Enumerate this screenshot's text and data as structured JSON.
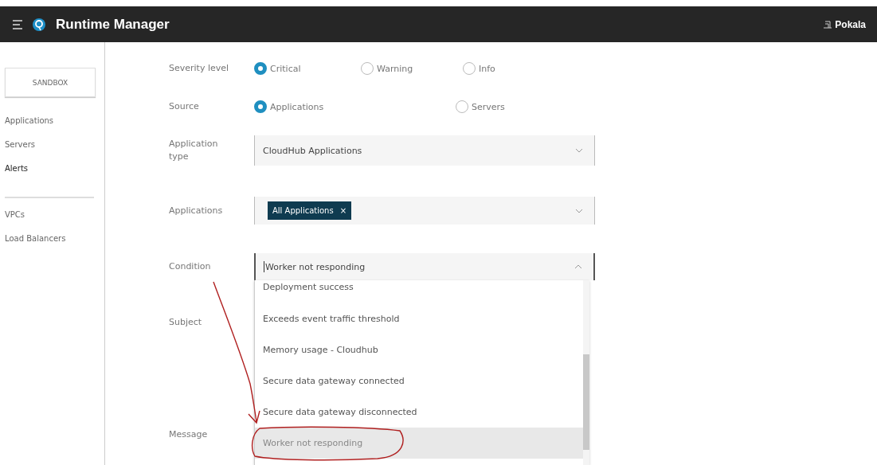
{
  "top_bar": {
    "title": "Runtime Manager",
    "user": "Pokala"
  },
  "sidebar": {
    "environment": "SANDBOX",
    "groups": [
      [
        {
          "label": "Applications",
          "selected": false
        },
        {
          "label": "Servers",
          "selected": false
        },
        {
          "label": "Alerts",
          "selected": true
        }
      ],
      [
        {
          "label": "VPCs",
          "selected": false
        },
        {
          "label": "Load Balancers",
          "selected": false
        }
      ]
    ]
  },
  "form": {
    "severity": {
      "label": "Severity level",
      "options": [
        {
          "label": "Critical",
          "selected": true
        },
        {
          "label": "Warning",
          "selected": false
        },
        {
          "label": "Info",
          "selected": false
        }
      ]
    },
    "source": {
      "label": "Source",
      "options": [
        {
          "label": "Applications",
          "selected": true
        },
        {
          "label": "Servers",
          "selected": false
        }
      ]
    },
    "application_type": {
      "label": "Application type",
      "value": "CloudHub Applications"
    },
    "applications": {
      "label": "Applications",
      "tags": [
        "All Applications"
      ],
      "tag_remove": "×"
    },
    "condition": {
      "label": "Condition",
      "value": "Worker not responding",
      "expanded": true,
      "options": [
        {
          "label": "Deployment success",
          "selected": false,
          "circled": false
        },
        {
          "label": "Exceeds event traffic threshold",
          "selected": false,
          "circled": false
        },
        {
          "label": "Memory usage - Cloudhub",
          "selected": false,
          "circled": false
        },
        {
          "label": "Secure data gateway connected",
          "selected": false,
          "circled": false
        },
        {
          "label": "Secure data gateway disconnected",
          "selected": false,
          "circled": false
        },
        {
          "label": "Worker not responding",
          "selected": true,
          "circled": true
        }
      ]
    },
    "subject": {
      "label": "Subject"
    },
    "message": {
      "label": "Message"
    }
  }
}
